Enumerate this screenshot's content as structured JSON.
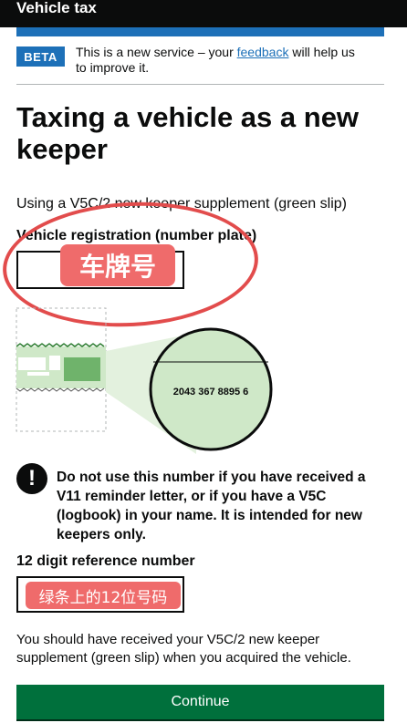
{
  "header": {
    "title": "Vehicle tax"
  },
  "phase_banner": {
    "tag": "BETA",
    "text_before": "This is a new service – your ",
    "link": "feedback",
    "text_after": " will help us to improve it."
  },
  "page": {
    "heading": "Taxing a vehicle as a new keeper",
    "intro": "Using a V5C/2 new keeper supplement (green slip)"
  },
  "vrn": {
    "label": "Vehicle registration (number plate)",
    "value": ""
  },
  "annotations": {
    "vrn_badge": "车牌号",
    "ref_badge": "绿条上的12位号码"
  },
  "illustration": {
    "number": "2043 367 8895 6"
  },
  "warning": {
    "icon": "!",
    "text": "Do not use this number if you have received a V11 reminder letter, or if you have a V5C (logbook) in your name. It is intended for new keepers only."
  },
  "reference": {
    "label": "12 digit reference number",
    "value": ""
  },
  "hint": "You should have received your V5C/2 new keeper supplement (green slip) when you acquired the vehicle.",
  "continue_button": "Continue",
  "colors": {
    "brand_blue": "#1d70b8",
    "button_green": "#00703c",
    "annotation_red": "#ef6b6b",
    "slip_green": "#cfe8c8"
  }
}
